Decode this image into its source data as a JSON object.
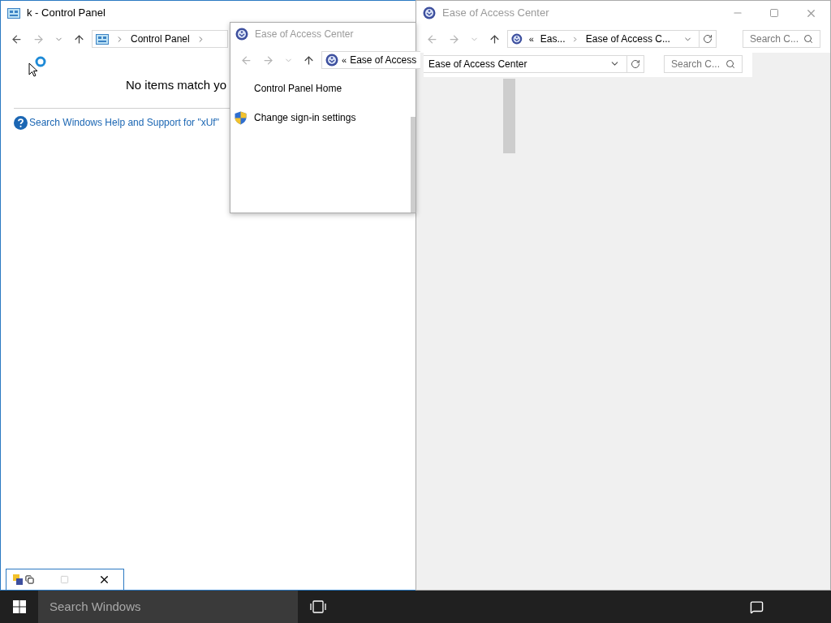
{
  "control_panel_window": {
    "title": "k - Control Panel",
    "active": true,
    "breadcrumbs": [
      "Control Panel"
    ],
    "message": "No items match yo",
    "help_link": "Search Windows Help and Support for \"xUf\""
  },
  "ease_window_small": {
    "title": "Ease of Access Center",
    "active": false,
    "overflow_mark": "«",
    "breadcrumbs": [
      "Ease of Access"
    ],
    "links": [
      {
        "kind": "plain",
        "label": "Control Panel Home"
      },
      {
        "kind": "shield",
        "label": "Change sign-in settings"
      }
    ]
  },
  "address_strip": {
    "breadcrumbs": [
      "Ease of Access Center"
    ],
    "search_placeholder": "Search C..."
  },
  "ease_window_large": {
    "title": "Ease of Access Center",
    "active": false,
    "overflow_mark": "«",
    "breadcrumbs": [
      "Eas...",
      "Ease of Access C..."
    ],
    "search_placeholder": "Search C..."
  },
  "taskbar": {
    "search_placeholder": "Search Windows"
  }
}
